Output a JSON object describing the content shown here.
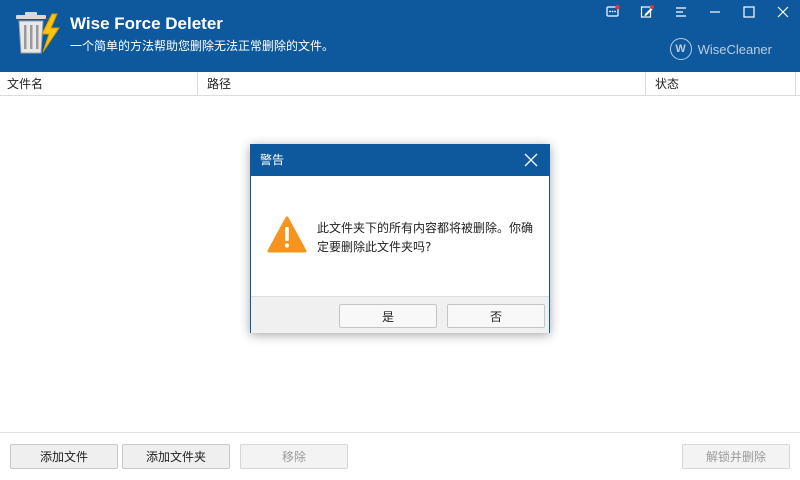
{
  "header": {
    "title": "Wise Force Deleter",
    "subtitle": "一个简单的方法帮助您删除无法正常删除的文件。",
    "brand": "WiseCleaner",
    "brand_mark": "W",
    "icons": [
      "feedback-icon",
      "edit-icon",
      "menu-icon",
      "minimize-icon",
      "maximize-icon",
      "close-icon"
    ]
  },
  "table": {
    "columns": [
      "文件名",
      "路径",
      "状态"
    ],
    "rows": []
  },
  "toolbar": {
    "add_file": "添加文件",
    "add_folder": "添加文件夹",
    "remove": "移除",
    "unlock_delete": "解锁并删除"
  },
  "dialog": {
    "title": "警告",
    "message": "此文件夹下的所有内容都将被删除。你确定要删除此文件夹吗?",
    "yes": "是",
    "no": "否"
  },
  "colors": {
    "header_bg": "#0e589d",
    "warning": "#f7941d",
    "notification_dot": "#e63333"
  }
}
